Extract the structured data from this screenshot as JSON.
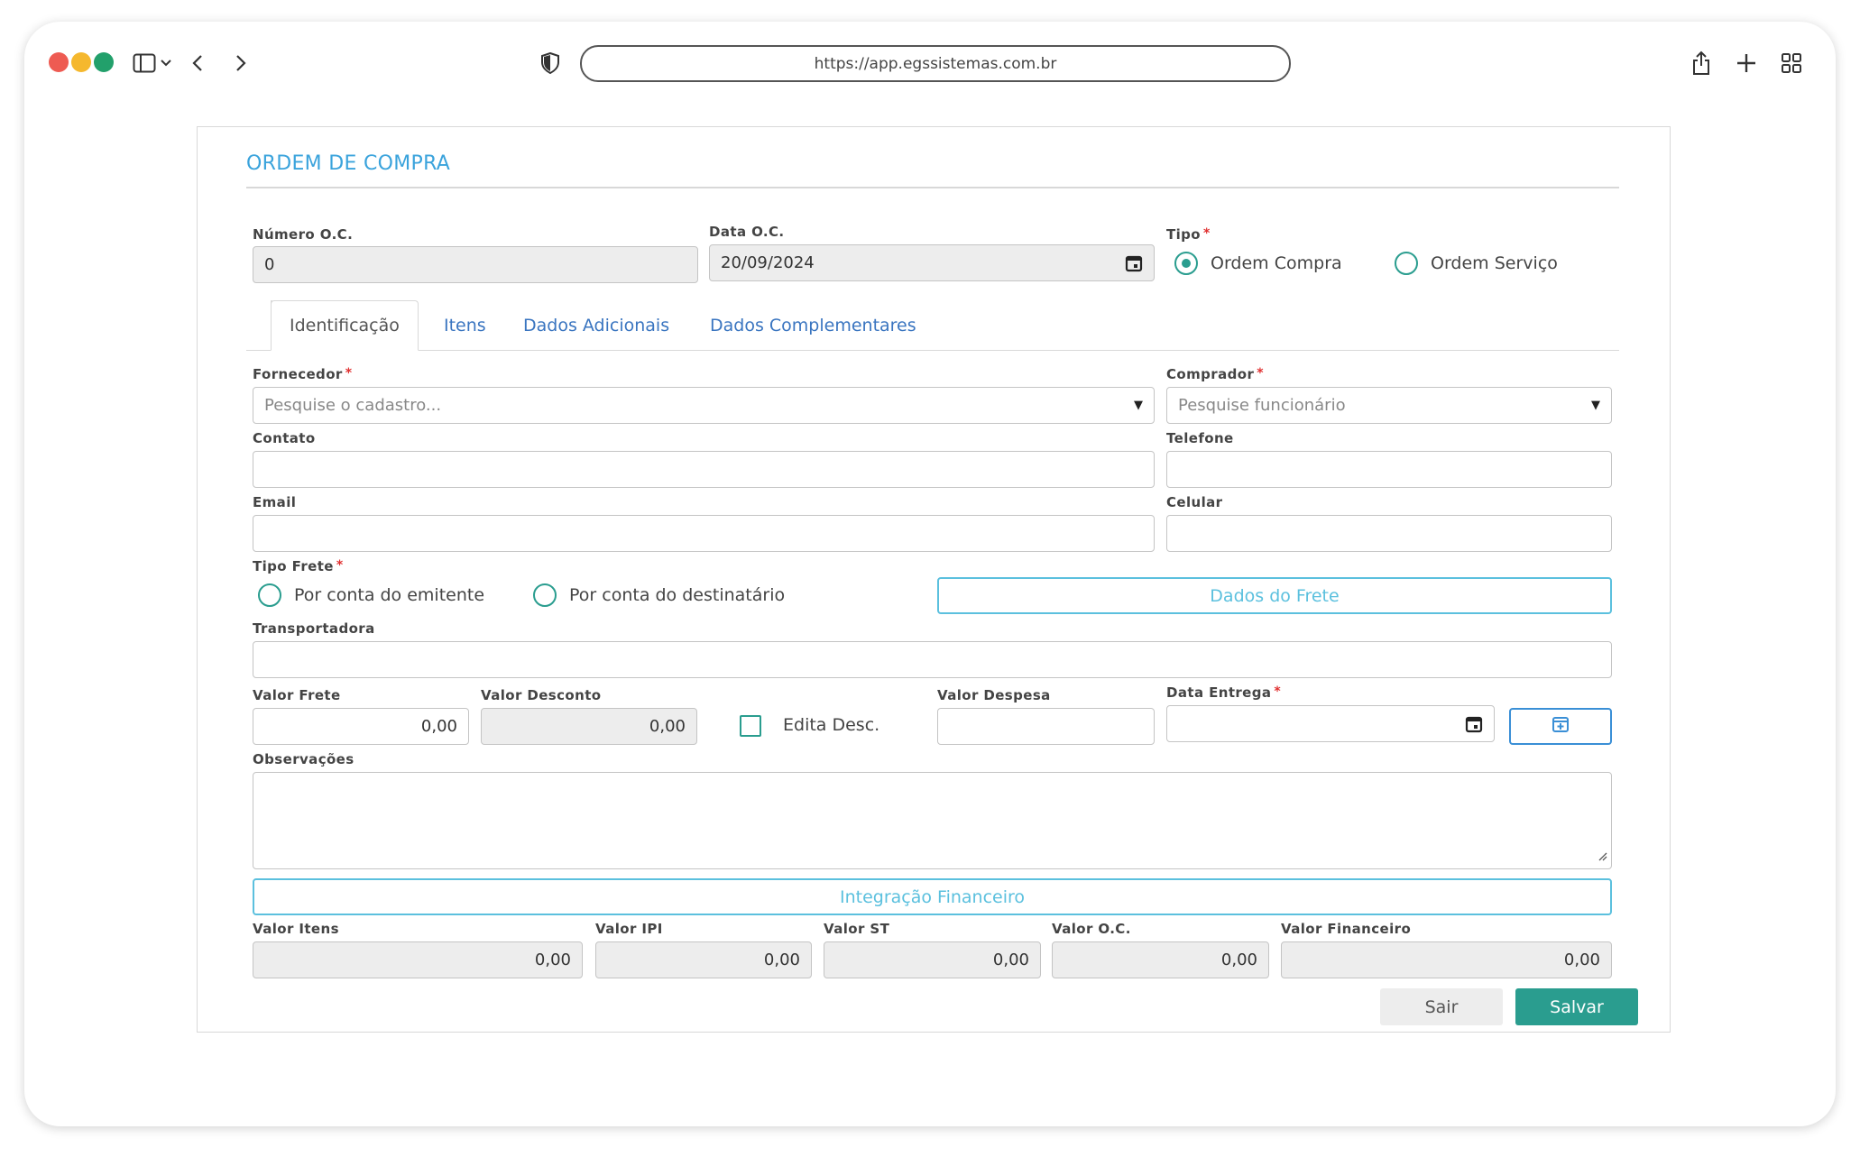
{
  "browser": {
    "url": "https://app.egssistemas.com.br",
    "dot_colors": [
      "#ee5b52",
      "#f5b82e",
      "#22a06b"
    ]
  },
  "form": {
    "title": "ORDEM DE COMPRA",
    "numero_oc": {
      "label": "Número O.C.",
      "value": "0"
    },
    "data_oc": {
      "label": "Data O.C.",
      "value": "20/09/2024"
    },
    "tipo": {
      "label": "Tipo",
      "options": [
        "Ordem Compra",
        "Ordem Serviço"
      ],
      "selected": "Ordem Compra"
    },
    "tabs": [
      "Identificação",
      "Itens",
      "Dados Adicionais",
      "Dados Complementares"
    ],
    "active_tab": "Identificação",
    "fornecedor": {
      "label": "Fornecedor",
      "placeholder": "Pesquise o cadastro..."
    },
    "comprador": {
      "label": "Comprador",
      "placeholder": "Pesquise funcionário"
    },
    "contato": {
      "label": "Contato",
      "value": ""
    },
    "telefone": {
      "label": "Telefone",
      "value": ""
    },
    "email": {
      "label": "Email",
      "value": ""
    },
    "celular": {
      "label": "Celular",
      "value": ""
    },
    "tipo_frete": {
      "label": "Tipo Frete",
      "options": [
        "Por conta do emitente",
        "Por conta do destinatário"
      ]
    },
    "dados_frete_button": "Dados do Frete",
    "transportadora": {
      "label": "Transportadora",
      "value": ""
    },
    "valor_frete": {
      "label": "Valor Frete",
      "value": "0,00"
    },
    "valor_desconto": {
      "label": "Valor Desconto",
      "value": "0,00"
    },
    "edita_desc": {
      "label": "Edita Desc.",
      "checked": false
    },
    "valor_despesa": {
      "label": "Valor Despesa",
      "value": ""
    },
    "data_entrega": {
      "label": "Data Entrega",
      "value": ""
    },
    "observacoes": {
      "label": "Observações",
      "value": ""
    },
    "integracao_button": "Integração Financeiro",
    "totals": [
      {
        "label": "Valor Itens",
        "value": "0,00"
      },
      {
        "label": "Valor IPI",
        "value": "0,00"
      },
      {
        "label": "Valor ST",
        "value": "0,00"
      },
      {
        "label": "Valor O.C.",
        "value": "0,00"
      },
      {
        "label": "Valor Financeiro",
        "value": "0,00"
      }
    ],
    "sair_button": "Sair",
    "salvar_button": "Salvar"
  },
  "colors": {
    "accent": "#2a9d8f",
    "title": "#3aa3dc",
    "outline_button": "#5bc0de",
    "required": "#e03030"
  }
}
